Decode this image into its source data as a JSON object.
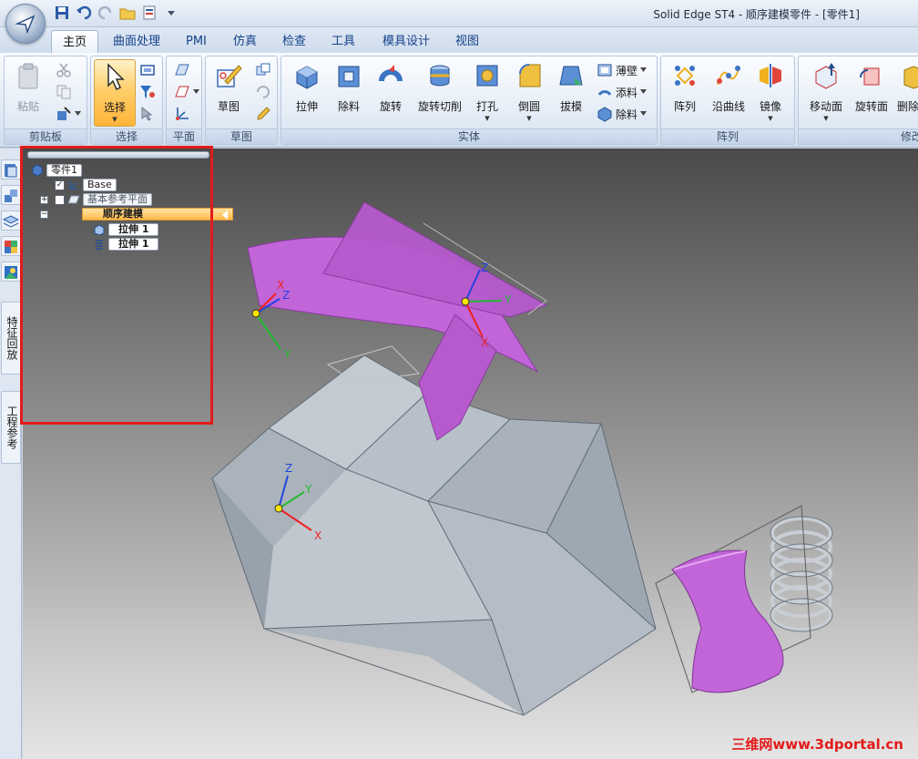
{
  "window": {
    "title": "Solid Edge ST4 - 顺序建模零件 - [零件1]"
  },
  "tabs": [
    {
      "label": "主页"
    },
    {
      "label": "曲面处理"
    },
    {
      "label": "PMI"
    },
    {
      "label": "仿真"
    },
    {
      "label": "检查"
    },
    {
      "label": "工具"
    },
    {
      "label": "模具设计"
    },
    {
      "label": "视图"
    }
  ],
  "ribbon": {
    "clipboard": {
      "paste": "粘贴",
      "group": "剪贴板"
    },
    "select": {
      "select": "选择",
      "group": "选择"
    },
    "plane": {
      "group": "平面"
    },
    "sketch": {
      "sketch": "草图",
      "group": "草图"
    },
    "solid": {
      "extrude": "拉伸",
      "cutout": "除料",
      "revolve": "旋转",
      "revolve_cut": "旋转切削",
      "hole": "打孔",
      "round": "倒圆",
      "draft": "拔模",
      "thin_wall": "薄壁",
      "add": "添料",
      "remove": "除料",
      "group": "实体"
    },
    "pattern": {
      "pattern": "阵列",
      "along_curve": "沿曲线",
      "mirror": "镜像",
      "group": "阵列"
    },
    "modify": {
      "move_face": "移动面",
      "rotate_face": "旋转面",
      "delete_face": "删除面",
      "group": "修改"
    }
  },
  "side_tabs": {
    "feature_playback": "特征回放",
    "engineering_ref": "工程参考"
  },
  "pathfinder": {
    "root": "零件1",
    "base": "Base",
    "ref_planes": "基本参考平面",
    "ordered": "顺序建模",
    "feature1": "拉伸 1",
    "feature2": "拉伸 1"
  },
  "watermark": "三维网www.3dportal.cn",
  "colors": {
    "accent": "#ffb94a",
    "highlight_box": "#e21b1b",
    "surface": "#c45fd6",
    "solid": "#b9c2cc"
  }
}
